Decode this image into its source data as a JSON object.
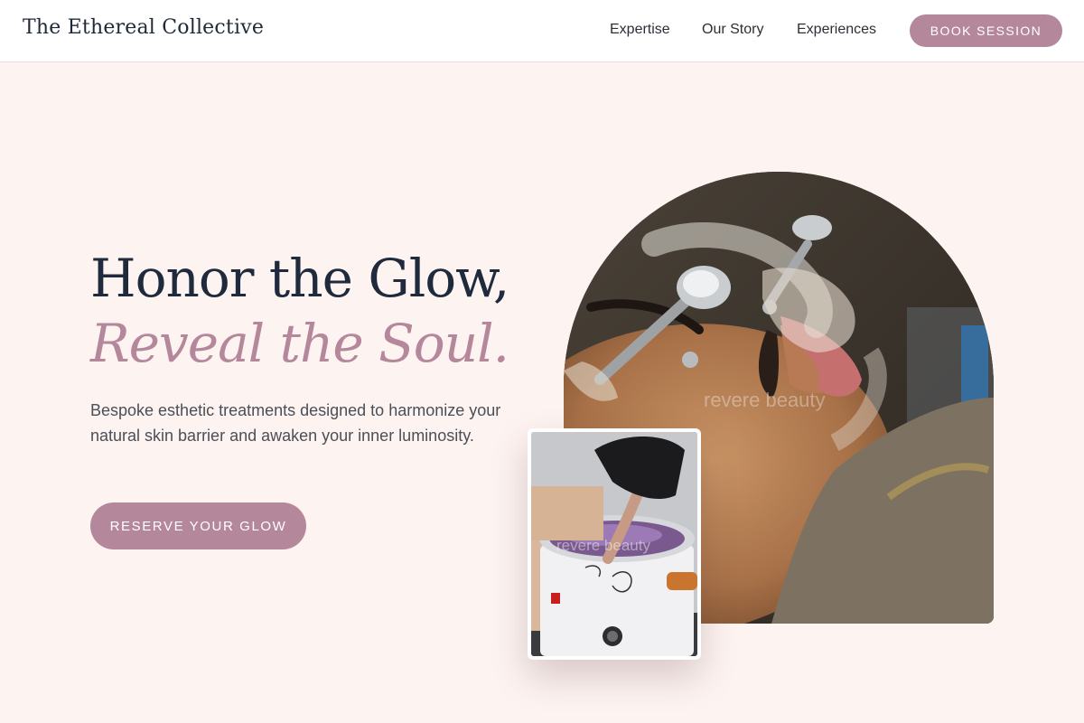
{
  "header": {
    "brand": "The Ethereal Collective",
    "nav": [
      "Expertise",
      "Our Story",
      "Experiences"
    ],
    "book_label": "BOOK SESSION"
  },
  "hero": {
    "headline_line1": "Honor the Glow,",
    "headline_line2": "Reveal the Soul.",
    "subtext": "Bespoke esthetic treatments designed to harmonize your natural skin barrier and awaken your inner luminosity.",
    "cta_label": "RESERVE YOUR GLOW"
  },
  "images": {
    "main_watermark": "revere beauty",
    "inset_watermark": "revere beauty"
  },
  "colors": {
    "accent": "#b5879b",
    "background": "#fdf3f1",
    "heading": "#1f2a3c"
  }
}
